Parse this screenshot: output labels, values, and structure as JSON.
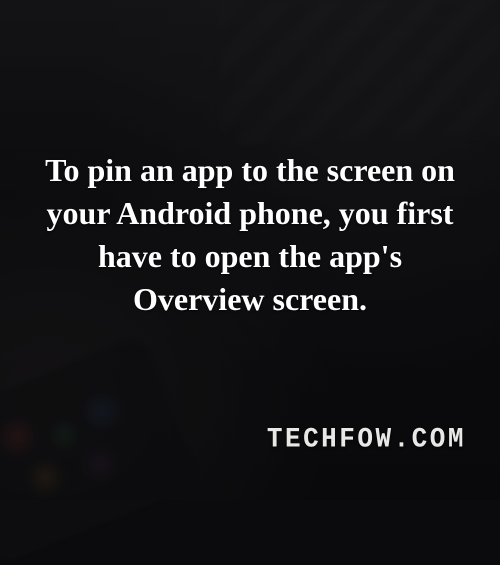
{
  "main_text": "To pin an app to the screen on your Android phone, you first have to open the app's Overview screen.",
  "watermark": "TECHFOW.COM"
}
